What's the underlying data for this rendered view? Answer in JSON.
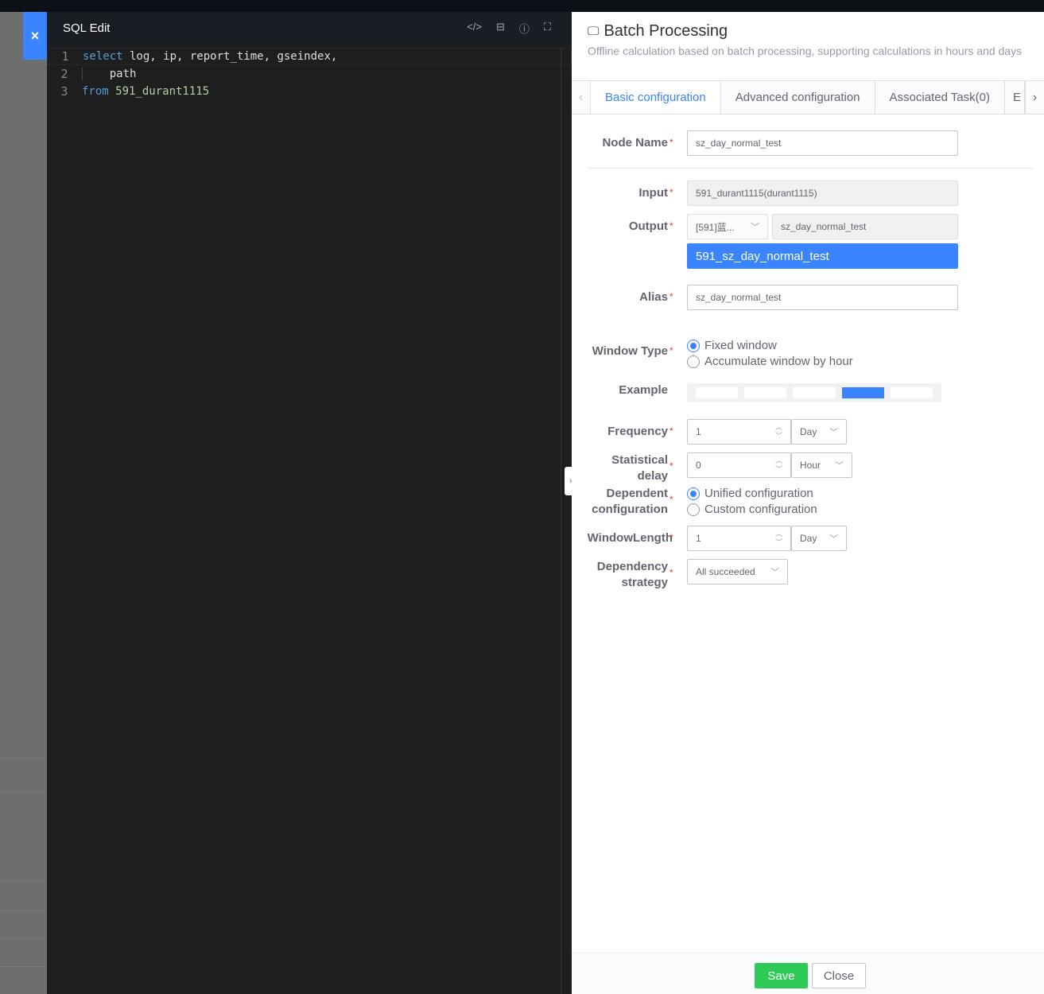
{
  "editor": {
    "title": "SQL Edit",
    "close_icon": "×",
    "lines": [
      {
        "n": "1",
        "kw": "select",
        "rest": " log, ip, report_time, gseindex,"
      },
      {
        "n": "2",
        "kw": "",
        "rest": "    path"
      },
      {
        "n": "3",
        "kw": "from",
        "num": " 591_durant1115"
      }
    ]
  },
  "panel": {
    "title": "Batch Processing",
    "desc": "Offline calculation based on batch processing, supporting calculations in hours and days",
    "tabs": [
      "Basic configuration",
      "Advanced configuration",
      "Associated Task(0)",
      "E"
    ],
    "form": {
      "node_name": {
        "label": "Node Name",
        "value": "sz_day_normal_test"
      },
      "input": {
        "label": "Input",
        "value": "591_durant1115(durant1115)"
      },
      "output": {
        "label": "Output",
        "biz": "[591]蓝...",
        "value": "sz_day_normal_test",
        "result": "591_sz_day_normal_test"
      },
      "alias": {
        "label": "Alias",
        "value": "sz_day_normal_test"
      },
      "window_type": {
        "label": "Window Type",
        "options": [
          "Fixed window",
          "Accumulate window by hour"
        ],
        "selected": 0
      },
      "example": {
        "label": "Example",
        "highlight_index": 3,
        "segments": 5
      },
      "frequency": {
        "label": "Frequency",
        "value": "1",
        "unit": "Day"
      },
      "delay": {
        "label1": "Statistical",
        "label2": "delay",
        "value": "0",
        "unit": "Hour"
      },
      "dependent": {
        "label1": "Dependent",
        "label2": "configuration",
        "options": [
          "Unified configuration",
          "Custom configuration"
        ],
        "selected": 0
      },
      "window_length": {
        "label": "WindowLength",
        "value": "1",
        "unit": "Day"
      },
      "strategy": {
        "label1": "Dependency",
        "label2": "strategy",
        "value": "All succeeded"
      }
    },
    "save": "Save",
    "close": "Close"
  },
  "colors": {
    "accent": "#3a84ff",
    "save": "#2dcb56"
  }
}
